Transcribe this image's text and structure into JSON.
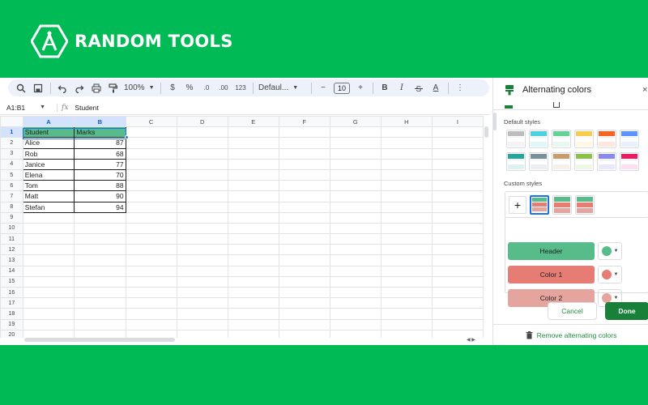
{
  "brand": {
    "name": "RANDOM TOOLS"
  },
  "toolbar": {
    "zoom": "100%",
    "currency_symbol": "$",
    "percent_symbol": "%",
    "dec_decrease": ".0",
    "dec_increase": ".00",
    "number_format": "123",
    "font": "Defaul...",
    "font_size": "10",
    "minus": "−",
    "plus": "+",
    "bold": "B",
    "italic": "I",
    "text_color_letter": "A",
    "more": "⋮"
  },
  "formula_bar": {
    "cell_ref": "A1:B1",
    "fx_label": "fx",
    "value": "Student"
  },
  "sheet": {
    "columns": [
      "A",
      "B",
      "C",
      "D",
      "E",
      "F",
      "G",
      "H",
      "I"
    ],
    "rows": [
      {
        "n": "1",
        "a": "Student",
        "b": "Marks"
      },
      {
        "n": "2",
        "a": "Alice",
        "b": "87"
      },
      {
        "n": "3",
        "a": "Rob",
        "b": "68"
      },
      {
        "n": "4",
        "a": "Janice",
        "b": "77"
      },
      {
        "n": "5",
        "a": "Elena",
        "b": "70"
      },
      {
        "n": "6",
        "a": "Tom",
        "b": "88"
      },
      {
        "n": "7",
        "a": "Matt",
        "b": "90"
      },
      {
        "n": "8",
        "a": "Stefan",
        "b": "94"
      },
      {
        "n": "9",
        "a": "",
        "b": ""
      },
      {
        "n": "10",
        "a": "",
        "b": ""
      },
      {
        "n": "11",
        "a": "",
        "b": ""
      },
      {
        "n": "12",
        "a": "",
        "b": ""
      },
      {
        "n": "13",
        "a": "",
        "b": ""
      },
      {
        "n": "14",
        "a": "",
        "b": ""
      },
      {
        "n": "15",
        "a": "",
        "b": ""
      },
      {
        "n": "16",
        "a": "",
        "b": ""
      },
      {
        "n": "17",
        "a": "",
        "b": ""
      },
      {
        "n": "18",
        "a": "",
        "b": ""
      },
      {
        "n": "19",
        "a": "",
        "b": ""
      },
      {
        "n": "20",
        "a": "",
        "b": ""
      }
    ]
  },
  "panel": {
    "title": "Alternating colors",
    "close": "×",
    "default_styles_label": "Default styles",
    "custom_styles_label": "Custom styles",
    "add_symbol": "+",
    "default_styles": [
      {
        "header": "#bdbdbd",
        "c1": "#ffffff",
        "c2": "#f3f3f3"
      },
      {
        "header": "#4dd0e1",
        "c1": "#ffffff",
        "c2": "#e0f7fa"
      },
      {
        "header": "#63d297",
        "c1": "#ffffff",
        "c2": "#e7f9ef"
      },
      {
        "header": "#f7cb4d",
        "c1": "#ffffff",
        "c2": "#fef8e3"
      },
      {
        "header": "#f46524",
        "c1": "#ffffff",
        "c2": "#ffe6dd"
      },
      {
        "header": "#5b95f9",
        "c1": "#ffffff",
        "c2": "#e8f0fe"
      },
      {
        "header": "#26a69a",
        "c1": "#ffffff",
        "c2": "#ddf2f0"
      },
      {
        "header": "#78909c",
        "c1": "#ffffff",
        "c2": "#ebeff1"
      },
      {
        "header": "#ca9b6c",
        "c1": "#ffffff",
        "c2": "#f7f0e9"
      },
      {
        "header": "#8bc34a",
        "c1": "#ffffff",
        "c2": "#eef7e3"
      },
      {
        "header": "#8989eb",
        "c1": "#ffffff",
        "c2": "#e8e7fc"
      },
      {
        "header": "#e91d63",
        "c1": "#ffffff",
        "c2": "#fddeee"
      }
    ],
    "colors": [
      {
        "label": "Header",
        "color": "#57bb8a",
        "bar_bg": "#57bb8a"
      },
      {
        "label": "Color 1",
        "color": "#e67c73",
        "bar_bg": "#e67c73"
      },
      {
        "label": "Color 2",
        "color": "#e6a49e",
        "bar_bg": "#e6a49e"
      }
    ],
    "cancel_label": "Cancel",
    "done_label": "Done",
    "remove_label": "Remove alternating colors"
  }
}
